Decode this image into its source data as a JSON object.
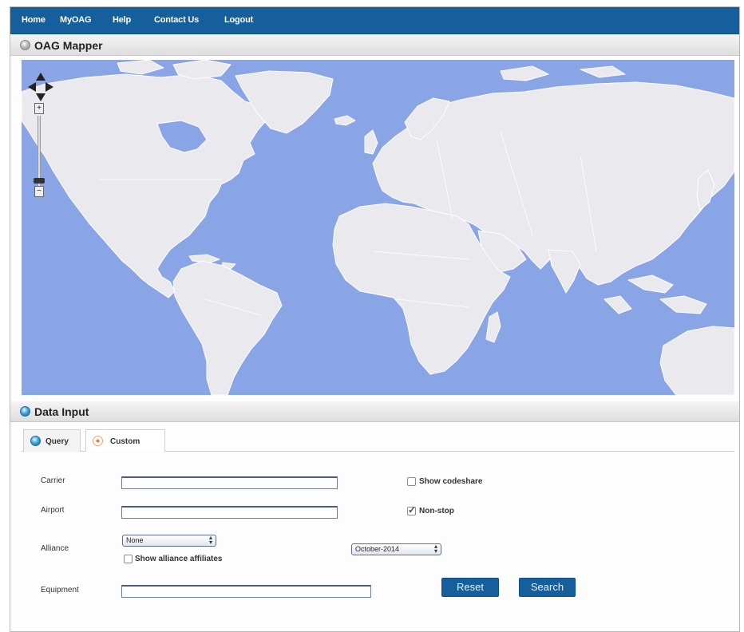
{
  "nav": {
    "items": [
      "Home",
      "MyOAG",
      "Help",
      "Contact Us",
      "Logout"
    ]
  },
  "mapper": {
    "title": "OAG Mapper",
    "zoom_in": "+",
    "zoom_out": "−"
  },
  "data_input": {
    "title": "Data Input",
    "tabs": [
      "Query",
      "Custom"
    ],
    "active_tab": "Query",
    "carrier": {
      "label": "Carrier",
      "value": ""
    },
    "airport": {
      "label": "Airport",
      "value": ""
    },
    "alliance": {
      "label": "Alliance",
      "selected": "None"
    },
    "alliance_affiliates": {
      "label": "Show alliance affiliates",
      "checked": false
    },
    "equipment": {
      "label": "Equipment",
      "value": ""
    },
    "show_codeshare": {
      "label": "Show codeshare",
      "checked": false
    },
    "non_stop": {
      "label": "Non-stop",
      "checked": true
    },
    "date": {
      "selected": "October-2014"
    },
    "reset_label": "Reset",
    "search_label": "Search"
  },
  "colors": {
    "nav_bg": "#155f9d",
    "ocean": "#8aa5e6",
    "land": "#e9e9ee",
    "button": "#155f9d"
  }
}
